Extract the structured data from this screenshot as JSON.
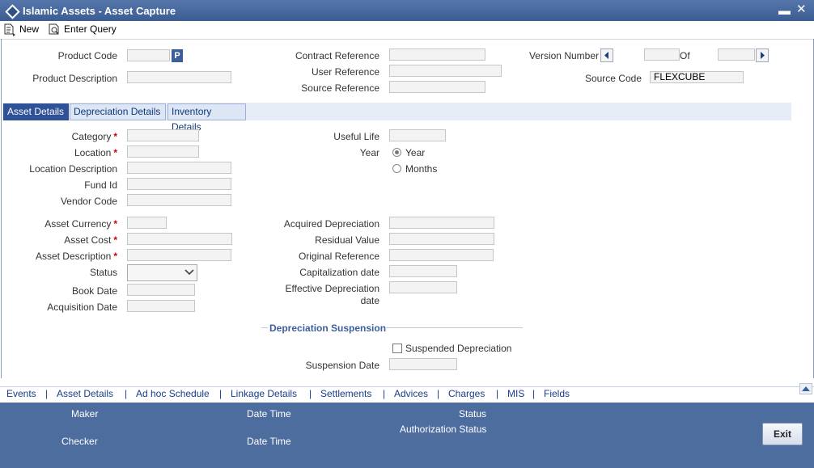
{
  "window": {
    "title": "Islamic Assets - Asset Capture",
    "minimize": "▬",
    "close": "✕"
  },
  "toolbar": {
    "new_label": "New",
    "enter_query_label": "Enter Query"
  },
  "header": {
    "product_code_label": "Product Code",
    "product_code_btn": "P",
    "product_description_label": "Product Description",
    "contract_reference_label": "Contract Reference",
    "user_reference_label": "User Reference",
    "source_reference_label": "Source Reference",
    "version_number_label": "Version Number",
    "of_label": "Of",
    "source_code_label": "Source Code",
    "source_code_value": "FLEXCUBE"
  },
  "tabs": [
    {
      "label": "Asset Details",
      "active": true
    },
    {
      "label": "Depreciation Details",
      "active": false
    },
    {
      "label": "Inventory Details",
      "active": false
    }
  ],
  "asset": {
    "category_label": "Category",
    "location_label": "Location",
    "location_description_label": "Location Description",
    "fund_id_label": "Fund Id",
    "vendor_code_label": "Vendor Code",
    "asset_currency_label": "Asset Currency",
    "asset_cost_label": "Asset Cost",
    "asset_description_label": "Asset Description",
    "status_label": "Status",
    "book_date_label": "Book Date",
    "acquisition_date_label": "Acquisition Date",
    "useful_life_label": "Useful Life",
    "year_label": "Year",
    "year_option": "Year",
    "months_option": "Months",
    "selected_period": "Year",
    "acquired_depreciation_label": "Acquired Depreciation",
    "residual_value_label": "Residual Value",
    "original_reference_label": "Original Reference",
    "capitalization_date_label": "Capitalization date",
    "effective_depreciation_label_1": "Effective Depreciation",
    "effective_depreciation_label_2": "date",
    "required_marker": "*"
  },
  "suspension": {
    "legend": "Depreciation Suspension",
    "suspended_depreciation_label": "Suspended Depreciation",
    "suspension_date_label": "Suspension Date"
  },
  "links": [
    "Events",
    "Asset Details",
    "Ad hoc Schedule",
    "Linkage Details",
    "Settlements",
    "Advices",
    "Charges",
    "MIS",
    "Fields"
  ],
  "link_separator": "|",
  "footer": {
    "maker_label": "Maker",
    "checker_label": "Checker",
    "date_time_label": "Date Time",
    "status_label": "Status",
    "authorization_status_label": "Authorization Status",
    "exit_label": "Exit"
  },
  "colors": {
    "title_bar": "#3c5d92",
    "footer": "#4e6d9f",
    "active_tab": "#2e5198",
    "link": "#173e8a",
    "required": "#cc0000"
  }
}
